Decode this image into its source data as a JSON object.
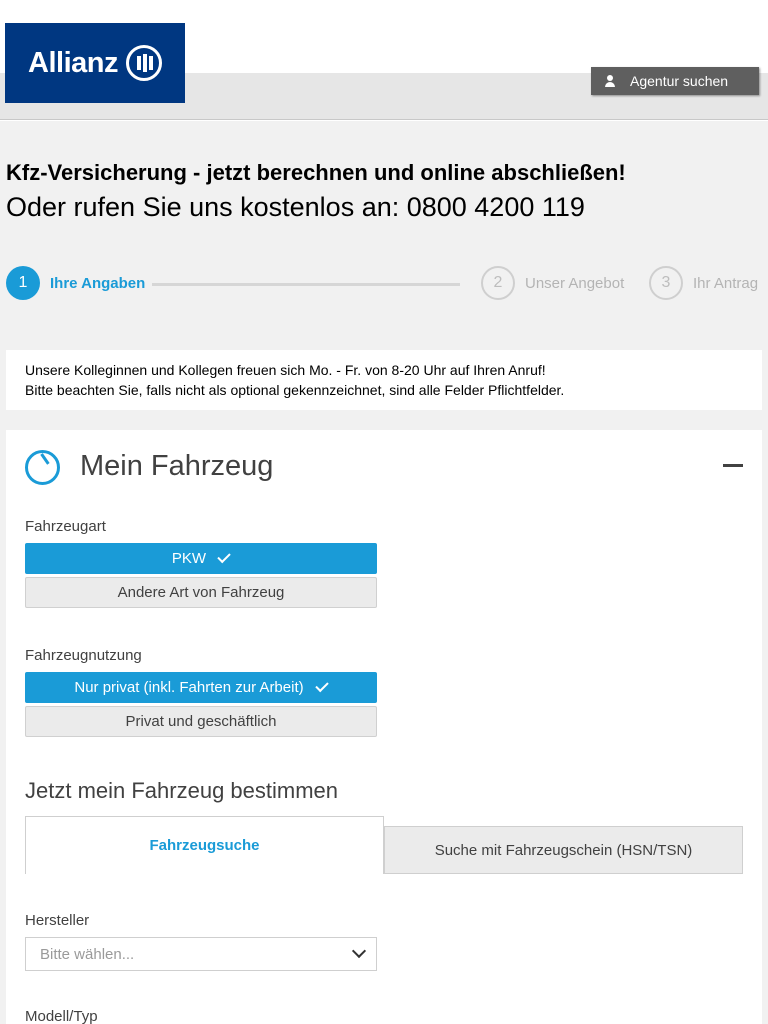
{
  "header": {
    "logo_text": "Allianz",
    "agent_button_label": "Agentur suchen"
  },
  "titles": {
    "headline": "Kfz-Versicherung - jetzt berechnen und online abschließen!",
    "phone_line": "Oder rufen Sie uns kostenlos an: 0800 4200 119"
  },
  "stepper": {
    "steps": [
      {
        "number": "1",
        "label": "Ihre Angaben"
      },
      {
        "number": "2",
        "label": "Unser Angebot"
      },
      {
        "number": "3",
        "label": "Ihr Antrag"
      }
    ]
  },
  "info": {
    "line1": "Unsere Kolleginnen und Kollegen freuen sich Mo. - Fr. von 8-20 Uhr auf Ihren Anruf!",
    "line2": "Bitte beachten Sie, falls nicht als optional gekennzeichnet, sind alle Felder Pflichtfelder."
  },
  "card": {
    "title": "Mein Fahrzeug",
    "fahrzeugart": {
      "label": "Fahrzeugart",
      "selected": "PKW",
      "other": "Andere Art von Fahrzeug"
    },
    "nutzung": {
      "label": "Fahrzeugnutzung",
      "selected": "Nur privat (inkl. Fahrten zur Arbeit)",
      "other": "Privat und geschäftlich"
    },
    "bestimmen": {
      "heading": "Jetzt mein Fahrzeug bestimmen",
      "tab_active": "Fahrzeugsuche",
      "tab_inactive": "Suche mit Fahrzeugschein (HSN/TSN)"
    },
    "hersteller": {
      "label": "Hersteller",
      "placeholder": "Bitte wählen..."
    },
    "modell": {
      "label": "Modell/Typ"
    }
  },
  "colors": {
    "brand": "#003781",
    "accent": "#1a9bd7"
  }
}
